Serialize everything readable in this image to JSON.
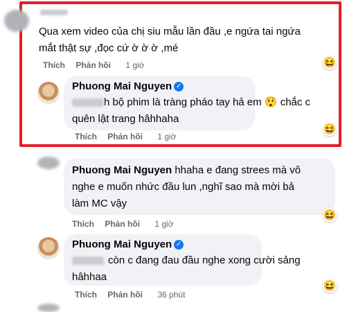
{
  "comments": [
    {
      "name": "",
      "text_line1": "Qua xem video của chị siu mẫu lần đầu ,e ngứa tai ngứa",
      "text_line2": "mắt thật sự ,đọc cứ ờ ờ ờ ,mé",
      "like": "Thích",
      "reply": "Phản hồi",
      "time": "1 giờ",
      "reaction": "haha-icon"
    },
    {
      "name": "Phuong Mai Nguyen",
      "text_line1_pre": "h bộ phim là tràng pháo tay hả em",
      "text_line1_post": "chắc c",
      "text_line2": "quên lật trang hâhhaha",
      "like": "Thích",
      "reply": "Phản hồi",
      "time": "1 giờ",
      "reaction": "haha-icon"
    },
    {
      "name": "Phuong Mai Nguyen",
      "text_line1": "hhaha e đang strees mà vô",
      "text_line2": "nghe e muốn nhức đầu lun ,nghĩ sao mà mời bả",
      "text_line3": "làm MC vậy",
      "like": "Thích",
      "reply": "Phản hồi",
      "time": "1 giờ",
      "reaction": "haha-icon"
    },
    {
      "name": "Phuong Mai Nguyen",
      "text_line1": "còn c đang đau đầu nghe xong cười sảng",
      "text_line2": "hâhhaa",
      "like": "Thích",
      "reply": "Phản hồi",
      "time": "36 phút",
      "reaction": "haha-icon"
    }
  ],
  "colors": {
    "highlight": "#e41e2b",
    "verified": "#1877f2",
    "bubble": "#f0f2f5"
  }
}
